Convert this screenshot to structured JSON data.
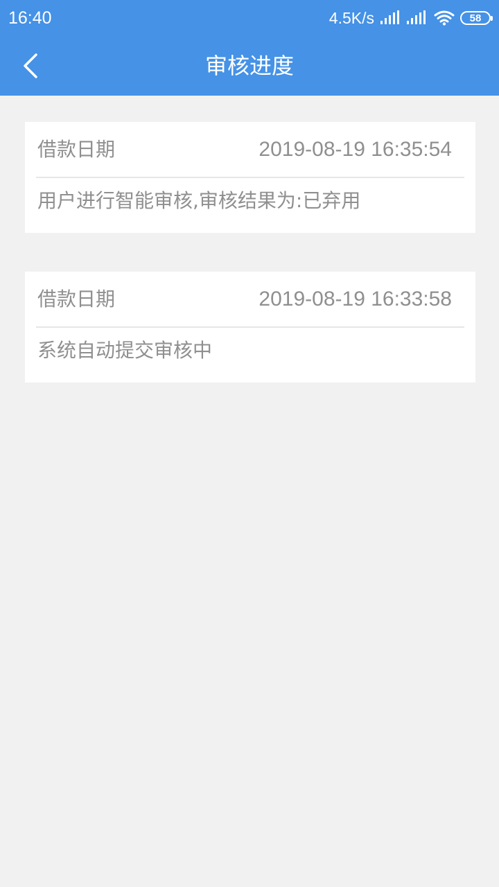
{
  "status_bar": {
    "time": "16:40",
    "net_speed": "4.5K/s",
    "battery": "58",
    "icons": [
      "signal-icon",
      "signal-icon",
      "wifi-icon",
      "battery-icon"
    ]
  },
  "nav": {
    "title": "审核进度",
    "back_icon": "chevron-left-icon"
  },
  "records": [
    {
      "label": "借款日期",
      "datetime": "2019-08-19 16:35:54",
      "description": "用户进行智能审核,审核结果为:已弃用"
    },
    {
      "label": "借款日期",
      "datetime": "2019-08-19 16:33:58",
      "description": "系统自动提交审核中"
    }
  ],
  "colors": {
    "header": "#4592e6",
    "background": "#f1f1f1",
    "card": "#ffffff",
    "text_gray": "#8f8f8f",
    "divider": "#e6e6e6"
  }
}
